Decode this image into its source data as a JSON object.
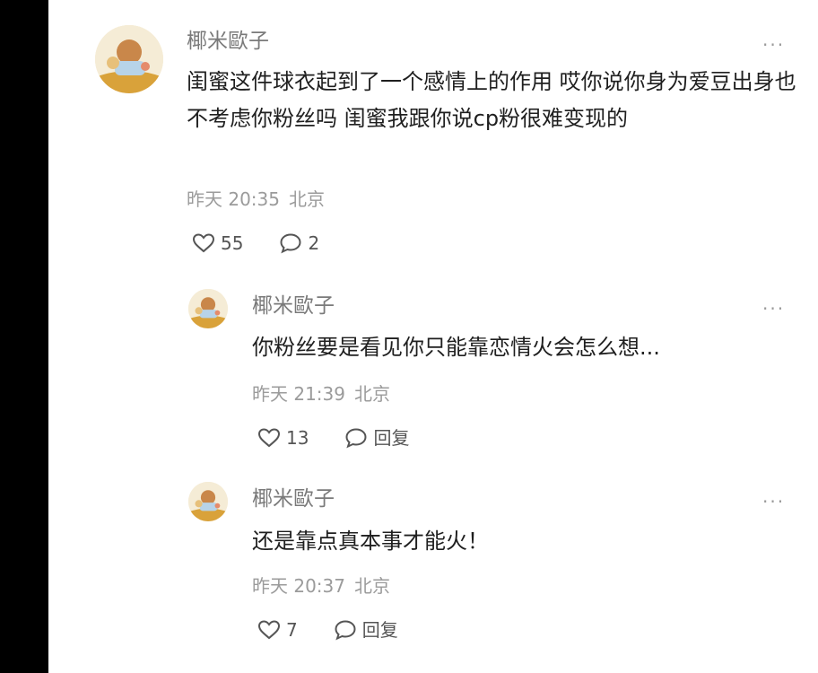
{
  "comments": [
    {
      "username": "椰米歐子",
      "text": "闺蜜这件球衣起到了一个感情上的作用 哎你说你身为爱豆出身也不考虑你粉丝吗 闺蜜我跟你说cp粉很难变现的",
      "time": "昨天 20:35",
      "location": "北京",
      "likes": "55",
      "replies": "2",
      "more_icon": "ellipsis-icon"
    },
    {
      "username": "椰米歐子",
      "text": "你粉丝要是看见你只能靠恋情火会怎么想...",
      "time": "昨天 21:39",
      "location": "北京",
      "likes": "13",
      "reply_label": "回复",
      "more_icon": "ellipsis-icon"
    },
    {
      "username": "椰米歐子",
      "text": "还是靠点真本事才能火！",
      "time": "昨天 20:37",
      "location": "北京",
      "likes": "7",
      "reply_label": "回复",
      "more_icon": "ellipsis-icon"
    }
  ],
  "icons": {
    "like": "heart-outline-icon",
    "comment": "speech-bubble-icon",
    "more": "ellipsis-icon"
  },
  "colors": {
    "username": "#7a7a7a",
    "body_text": "#1f1f1f",
    "meta": "#9b9b9b",
    "action": "#555555",
    "background": "#ffffff"
  }
}
